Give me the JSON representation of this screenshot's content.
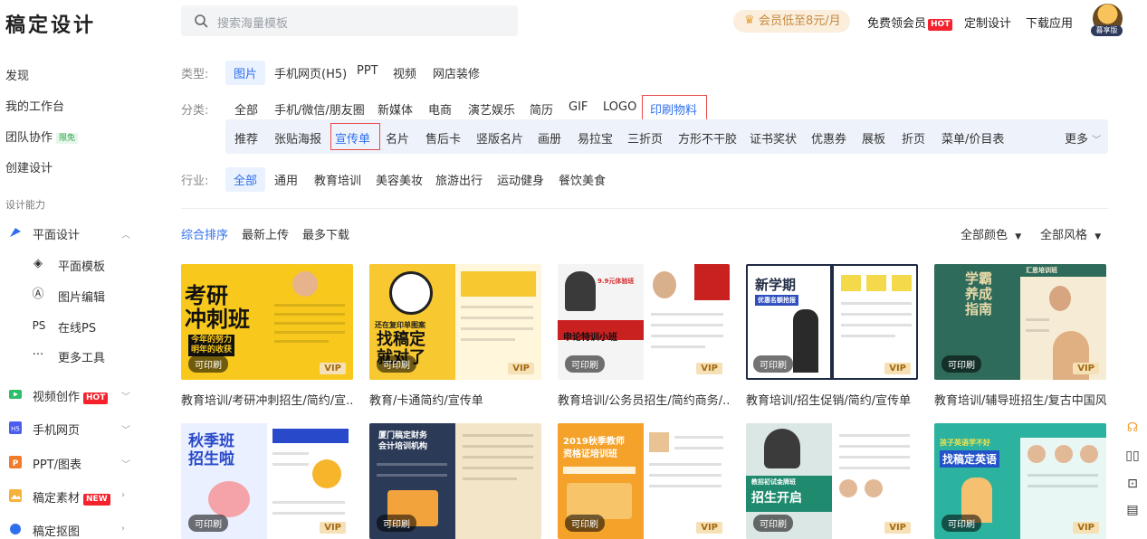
{
  "header": {
    "logo": "稿定设计",
    "search_placeholder": "搜索海量模板",
    "vip_pill": "会员低至8元/月",
    "free_vip": "免费领会员",
    "hot_badge": "HOT",
    "custom_design": "定制设计",
    "download_app": "下载应用",
    "avatar_tag": "暮享版"
  },
  "sidebar": {
    "top": [
      "发现",
      "我的工作台",
      "团队协作",
      "创建设计"
    ],
    "team_badge": "限免",
    "section": "设计能力",
    "groups": [
      {
        "label": "平面设计",
        "expanded": true
      },
      {
        "label": "视频创作",
        "badge": "HOT"
      },
      {
        "label": "手机网页"
      },
      {
        "label": "PPT/图表"
      },
      {
        "label": "稿定素材",
        "badge": "NEW"
      },
      {
        "label": "稿定抠图"
      }
    ],
    "sub": [
      "平面模板",
      "图片编辑",
      "在线PS",
      "更多工具"
    ],
    "sub_icons": [
      "layers-icon",
      "image-edit-icon",
      "ps-icon",
      "more-icon"
    ],
    "ps_prefix": "PS",
    "more_prefix": "···"
  },
  "filters": {
    "type_label": "类型:",
    "types": [
      "图片",
      "手机网页(H5)",
      "PPT",
      "视频",
      "网店装修"
    ],
    "category_label": "分类:",
    "categories": [
      "全部",
      "手机/微信/朋友圈",
      "新媒体",
      "电商",
      "演艺娱乐",
      "简历",
      "GIF",
      "LOGO",
      "印刷物料"
    ],
    "subcategories": [
      "推荐",
      "张贴海报",
      "宣传单",
      "名片",
      "售后卡",
      "竖版名片",
      "画册",
      "易拉宝",
      "三折页",
      "方形不干胶",
      "证书奖状",
      "优惠券",
      "展板",
      "折页",
      "菜单/价目表"
    ],
    "more": "更多",
    "industry_label": "行业:",
    "industries": [
      "全部",
      "通用",
      "教育培训",
      "美容美妆",
      "旅游出行",
      "运动健身",
      "餐饮美食"
    ]
  },
  "sort": {
    "options": [
      "综合排序",
      "最新上传",
      "最多下载"
    ],
    "color_filter": "全部颜色",
    "style_filter": "全部风格"
  },
  "cards": [
    {
      "title": "教育培训/考研冲刺招生/简约/宣...",
      "tag": "可印刷",
      "vip": "VIP",
      "art": "考研\n冲刺班",
      "sub": "今年的努力\n明年的收获"
    },
    {
      "title": "教育/卡通简约/宣传单",
      "tag": "可印刷",
      "vip": "VIP",
      "art": "找稿定\n就对了",
      "sub": "还在复印单图案"
    },
    {
      "title": "教育培训/公务员招生/简约商务/...",
      "tag": "可印刷",
      "vip": "VIP",
      "art": "申论特训小班",
      "sub": "9.9元体验班"
    },
    {
      "title": "教育培训/招生促销/简约/宣传单",
      "tag": "可印刷",
      "vip": "VIP",
      "art": "新学期",
      "sub": "优惠名额抢报"
    },
    {
      "title": "教育培训/辅导班招生/复古中国风...",
      "tag": "可印刷",
      "vip": "VIP",
      "art": "学霸\n养成\n指南",
      "sub": "汇思培训班"
    },
    {
      "title": "",
      "tag": "可印刷",
      "vip": "VIP",
      "art": "秋季班\n招生啦",
      "sub": ""
    },
    {
      "title": "",
      "tag": "可印刷",
      "vip": "",
      "art": "厦门稿定财务\n会计培训机构",
      "sub": ""
    },
    {
      "title": "",
      "tag": "可印刷",
      "vip": "VIP",
      "art": "2019秋季教师\n资格证培训班",
      "sub": ""
    },
    {
      "title": "",
      "tag": "可印刷",
      "vip": "VIP",
      "art": "招生开启",
      "sub": "教招初试金牌班"
    },
    {
      "title": "",
      "tag": "可印刷",
      "vip": "VIP",
      "art": "找稿定英语",
      "sub": "孩子英语学不好"
    }
  ],
  "float_icons": [
    "headset-icon",
    "book-icon",
    "feedback-icon",
    "chat-icon"
  ]
}
